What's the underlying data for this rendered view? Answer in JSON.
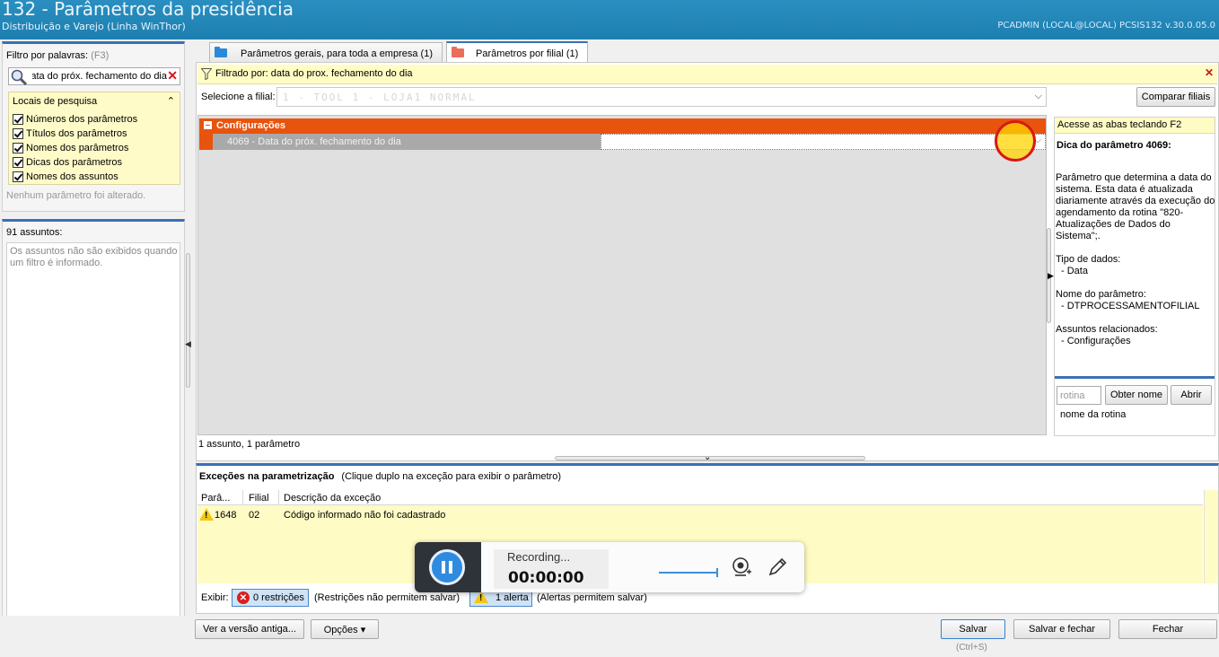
{
  "window": {
    "title": "132 - Parâmetros da presidência",
    "subtitle": "Distribuição e Varejo (Linha WinThor)",
    "session": "PCADMIN (LOCAL@LOCAL)   PCSIS132  v.30.0.05.0"
  },
  "filter": {
    "label": "Filtro por palavras:",
    "shortcut": "(F3)",
    "search_value": "data do próx. fechamento do dia",
    "locais_title": "Locais de pesquisa",
    "options": [
      {
        "label": "Números dos parâmetros",
        "checked": true
      },
      {
        "label": "Títulos dos parâmetros",
        "checked": true
      },
      {
        "label": "Nomes dos parâmetros",
        "checked": true
      },
      {
        "label": "Dicas dos parâmetros",
        "checked": true
      },
      {
        "label": "Nomes dos assuntos",
        "checked": true
      }
    ],
    "status": "Nenhum parâmetro foi alterado."
  },
  "assuntos": {
    "count_label": "91 assuntos:",
    "empty_msg": "Os assuntos não são exibidos quando um filtro é informado."
  },
  "tabs": [
    {
      "label": "Parâmetros gerais, para toda a empresa  (1)",
      "color": "#2a8ad8"
    },
    {
      "label": "Parâmetros por filial  (1)",
      "color": "#e96f5a",
      "active": true
    }
  ],
  "filter_bar": "Filtrado por: data do prox. fechamento do dia",
  "filial": {
    "label": "Selecione a filial:",
    "value": "1 - TOOL 1 - LOJA1 NORMAL",
    "compare_button": "Comparar filiais"
  },
  "grid": {
    "group": "Configurações",
    "row_name": "4069 - Data do próx. fechamento do dia",
    "row_value": "",
    "status": "1 assunto, 1 parâmetro"
  },
  "tip": {
    "header": "Acesse as abas teclando F2",
    "title": "Dica do parâmetro 4069:",
    "description": "Parâmetro que determina a data do sistema. Esta data é atualizada diariamente através da execução do agendamento da rotina \"820-Atualizações de Dados do Sistema\";.",
    "tipo_label": "Tipo de dados:",
    "tipo_value": "- Data",
    "nome_label": "Nome do parâmetro:",
    "nome_value": "- DTPROCESSAMENTOFILIAL",
    "assuntos_label": "Assuntos relacionados:",
    "assuntos_value": "- Configurações",
    "rotina_placeholder": "rotina",
    "obter_button": "Obter nome",
    "abrir_button": "Abrir",
    "rotina_name": "nome da rotina"
  },
  "excecoes": {
    "title": "Exceções na parametrização",
    "hint": "(Clique duplo na exceção para exibir o parâmetro)",
    "columns": [
      "Parâ...",
      "Filial",
      "Descrição da exceção"
    ],
    "rows": [
      {
        "param": "1648",
        "filial": "02",
        "descricao": "Código informado não foi cadastrado"
      }
    ]
  },
  "exibir": {
    "label": "Exibir:",
    "restricoes_badge": "0 restrições",
    "restricoes_note": "(Restrições não permitem salvar)",
    "alertas_badge": "1 alerta",
    "alertas_note": "(Alertas permitem salvar)"
  },
  "buttons": {
    "versao_antiga": "Ver a versão antiga...",
    "opcoes": "Opções ▾",
    "salvar": "Salvar",
    "salvar_shortcut": "(Ctrl+S)",
    "salvar_fechar": "Salvar e fechar",
    "fechar": "Fechar"
  },
  "recorder": {
    "status": "Recording...",
    "time": "00:00:00"
  }
}
